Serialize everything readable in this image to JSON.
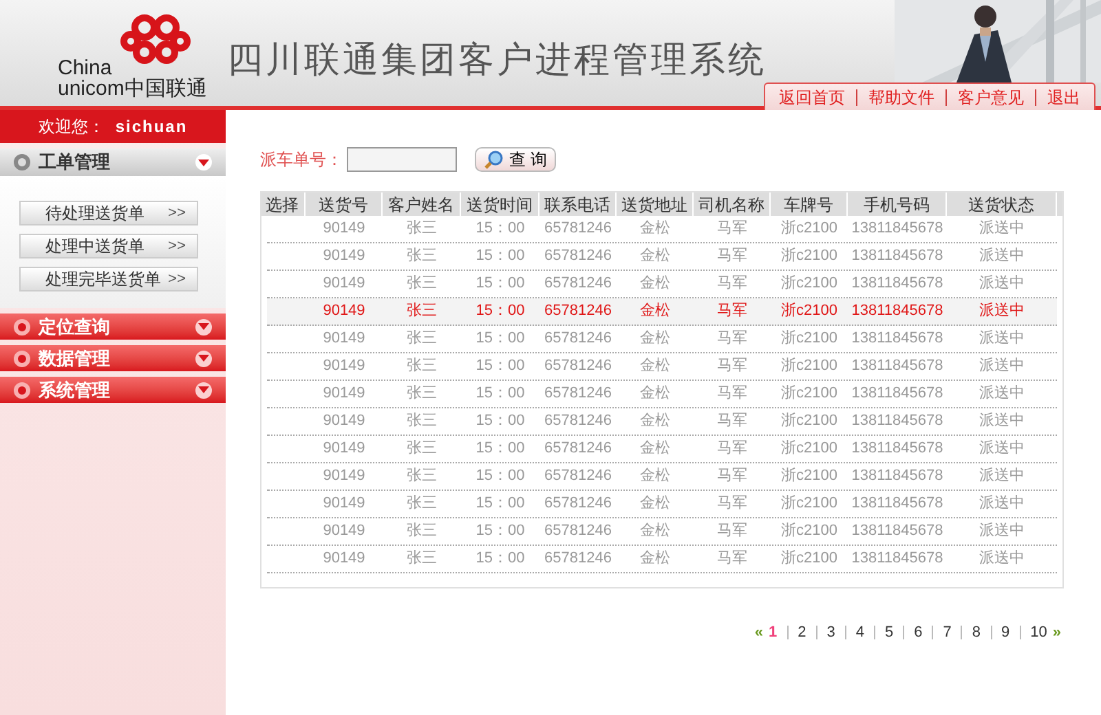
{
  "logo": {
    "line_1": "China",
    "line_2": "unicom中国联通"
  },
  "header": {
    "title": "四川联通集团客户进程管理系统"
  },
  "top_links": [
    "返回首页",
    "帮助文件",
    "客户意见",
    "退出"
  ],
  "sidebar": {
    "welcome_label": "欢迎您：",
    "user": "sichuan",
    "menus": [
      {
        "label": "工单管理",
        "expanded": true,
        "items": [
          {
            "label": "待处理送货单",
            "arrow": ">>"
          },
          {
            "label": "处理中送货单",
            "arrow": ">>"
          },
          {
            "label": "处理完毕送货单",
            "arrow": ">>"
          }
        ]
      },
      {
        "label": "定位查询",
        "expanded": false
      },
      {
        "label": "数据管理",
        "expanded": false
      },
      {
        "label": "系统管理",
        "expanded": false
      }
    ]
  },
  "search": {
    "label": "派车单号：",
    "button": "查 询"
  },
  "table": {
    "columns": [
      "选择",
      "送货号",
      "客户姓名",
      "送货时间",
      "联系电话",
      "送货地址",
      "司机名称",
      "车牌号",
      "手机号码",
      "送货状态"
    ],
    "rows": [
      {
        "selected": false,
        "cells": [
          "",
          "90149",
          "张三",
          "15：00",
          "65781246",
          "金松",
          "马军",
          "浙c2100",
          "13811845678",
          "派送中"
        ]
      },
      {
        "selected": false,
        "cells": [
          "",
          "90149",
          "张三",
          "15：00",
          "65781246",
          "金松",
          "马军",
          "浙c2100",
          "13811845678",
          "派送中"
        ]
      },
      {
        "selected": false,
        "cells": [
          "",
          "90149",
          "张三",
          "15：00",
          "65781246",
          "金松",
          "马军",
          "浙c2100",
          "13811845678",
          "派送中"
        ]
      },
      {
        "selected": true,
        "cells": [
          "",
          "90149",
          "张三",
          "15：00",
          "65781246",
          "金松",
          "马军",
          "浙c2100",
          "13811845678",
          "派送中"
        ]
      },
      {
        "selected": false,
        "cells": [
          "",
          "90149",
          "张三",
          "15：00",
          "65781246",
          "金松",
          "马军",
          "浙c2100",
          "13811845678",
          "派送中"
        ]
      },
      {
        "selected": false,
        "cells": [
          "",
          "90149",
          "张三",
          "15：00",
          "65781246",
          "金松",
          "马军",
          "浙c2100",
          "13811845678",
          "派送中"
        ]
      },
      {
        "selected": false,
        "cells": [
          "",
          "90149",
          "张三",
          "15：00",
          "65781246",
          "金松",
          "马军",
          "浙c2100",
          "13811845678",
          "派送中"
        ]
      },
      {
        "selected": false,
        "cells": [
          "",
          "90149",
          "张三",
          "15：00",
          "65781246",
          "金松",
          "马军",
          "浙c2100",
          "13811845678",
          "派送中"
        ]
      },
      {
        "selected": false,
        "cells": [
          "",
          "90149",
          "张三",
          "15：00",
          "65781246",
          "金松",
          "马军",
          "浙c2100",
          "13811845678",
          "派送中"
        ]
      },
      {
        "selected": false,
        "cells": [
          "",
          "90149",
          "张三",
          "15：00",
          "65781246",
          "金松",
          "马军",
          "浙c2100",
          "13811845678",
          "派送中"
        ]
      },
      {
        "selected": false,
        "cells": [
          "",
          "90149",
          "张三",
          "15：00",
          "65781246",
          "金松",
          "马军",
          "浙c2100",
          "13811845678",
          "派送中"
        ]
      },
      {
        "selected": false,
        "cells": [
          "",
          "90149",
          "张三",
          "15：00",
          "65781246",
          "金松",
          "马军",
          "浙c2100",
          "13811845678",
          "派送中"
        ]
      },
      {
        "selected": false,
        "cells": [
          "",
          "90149",
          "张三",
          "15：00",
          "65781246",
          "金松",
          "马军",
          "浙c2100",
          "13811845678",
          "派送中"
        ]
      }
    ]
  },
  "pagination": {
    "prev": "«",
    "next": "»",
    "pages": [
      {
        "label": "1",
        "selected": true
      },
      {
        "label": "2",
        "selected": false
      },
      {
        "label": "3",
        "selected": false
      },
      {
        "label": "4",
        "selected": false
      },
      {
        "label": "5",
        "selected": false
      },
      {
        "label": "6",
        "selected": false
      },
      {
        "label": "7",
        "selected": false
      },
      {
        "label": "8",
        "selected": false
      },
      {
        "label": "9",
        "selected": false
      },
      {
        "label": "10",
        "selected": false
      }
    ]
  }
}
